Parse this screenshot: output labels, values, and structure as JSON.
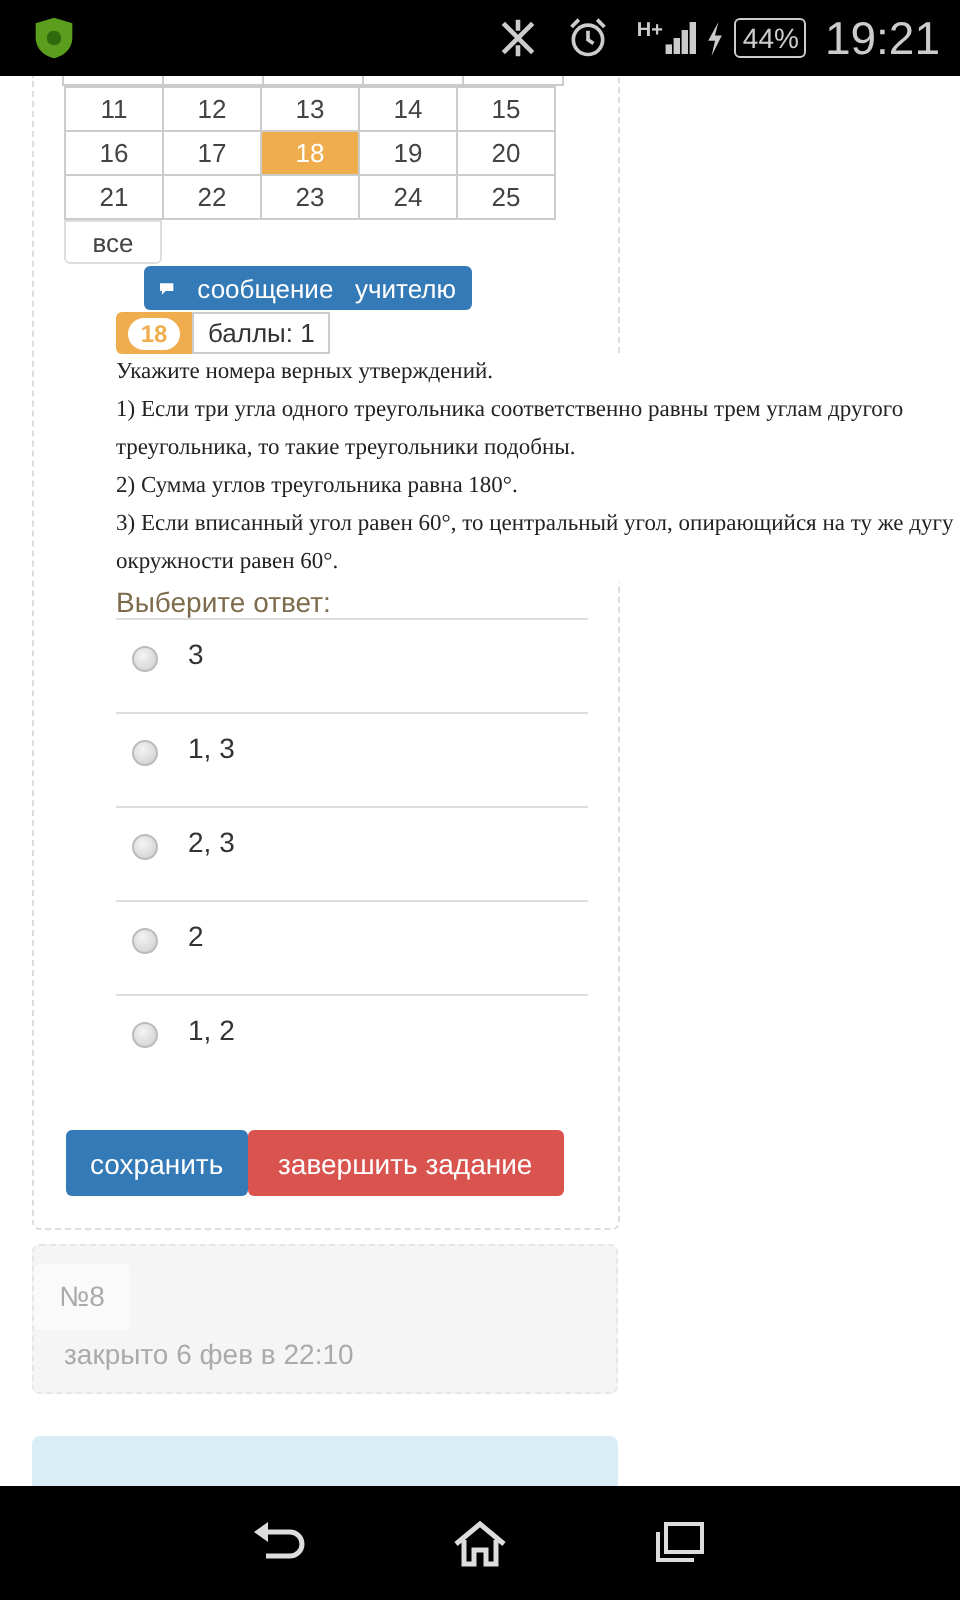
{
  "status_bar": {
    "network": "H+",
    "battery": "44%",
    "time": "19:21"
  },
  "calendar": {
    "weeks": [
      [
        {
          "day": "11",
          "selected": false
        },
        {
          "day": "12",
          "selected": false
        },
        {
          "day": "13",
          "selected": false
        },
        {
          "day": "14",
          "selected": false
        },
        {
          "day": "15",
          "selected": false
        }
      ],
      [
        {
          "day": "16",
          "selected": false
        },
        {
          "day": "17",
          "selected": false
        },
        {
          "day": "18",
          "selected": true
        },
        {
          "day": "19",
          "selected": false
        },
        {
          "day": "20",
          "selected": false
        }
      ],
      [
        {
          "day": "21",
          "selected": false
        },
        {
          "day": "22",
          "selected": false
        },
        {
          "day": "23",
          "selected": false
        },
        {
          "day": "24",
          "selected": false
        },
        {
          "day": "25",
          "selected": false
        }
      ]
    ],
    "all_button": "все"
  },
  "message_button": "сообщение   учителю",
  "task": {
    "number": "18",
    "points": "баллы: 1",
    "question": [
      "Укажите номера верных утверждений.",
      "1) Если три угла одного треугольника соответственно равны трем углам другого  треугольника, то такие треугольники подобны.",
      "2) Сумма углов треугольника равна 180°.",
      "3) Если вписанный угол равен 60°, то центральный угол, опирающийся на ту же дугу окружности равен 60°."
    ],
    "answer_prompt": "Выберите ответ:",
    "options": [
      {
        "label": "3",
        "selected": false
      },
      {
        "label": "1, 3",
        "selected": false
      },
      {
        "label": "2, 3",
        "selected": false
      },
      {
        "label": "2",
        "selected": false
      },
      {
        "label": "1, 2",
        "selected": false
      }
    ],
    "buttons": [
      {
        "label": "сохранить",
        "kind": "primary"
      },
      {
        "label": "завершить задание",
        "kind": "danger"
      }
    ]
  },
  "next_task": {
    "number": "№8",
    "status": "закрыто 6 фев в 22:10"
  }
}
